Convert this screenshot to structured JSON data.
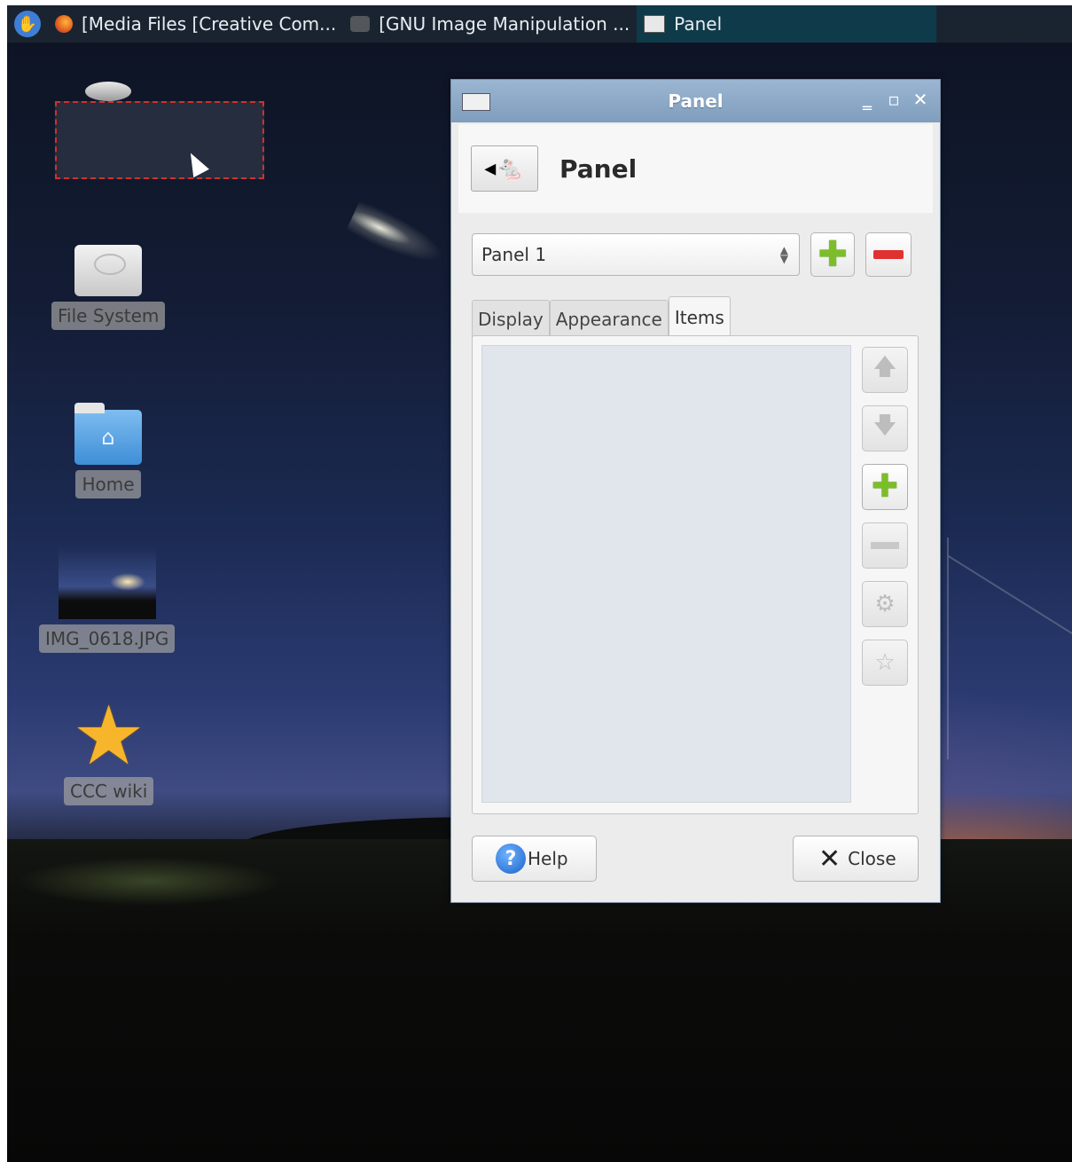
{
  "taskbar": {
    "tasks": [
      {
        "label": "[Media Files [Creative Com...",
        "icon": "firefox-icon"
      },
      {
        "label": "[GNU Image Manipulation ...",
        "icon": "gimp-icon"
      },
      {
        "label": "Panel",
        "icon": "panel-icon",
        "active": true
      }
    ]
  },
  "desktop": {
    "icons": [
      {
        "label": "File System",
        "icon": "hard-disk-icon"
      },
      {
        "label": "Home",
        "icon": "home-folder-icon"
      },
      {
        "label": "IMG_0618.JPG",
        "icon": "image-thumbnail-icon"
      },
      {
        "label": "CCC wiki",
        "icon": "star-icon"
      }
    ]
  },
  "dialog": {
    "title": "Panel",
    "header_title": "Panel",
    "panel_select": {
      "value": "Panel 1"
    },
    "tabs": [
      {
        "label": "Display"
      },
      {
        "label": "Appearance"
      },
      {
        "label": "Items",
        "active": true
      }
    ],
    "items": [],
    "side_buttons": [
      {
        "icon": "arrow-up-icon",
        "enabled": false
      },
      {
        "icon": "arrow-down-icon",
        "enabled": false
      },
      {
        "icon": "add-icon",
        "enabled": true
      },
      {
        "icon": "remove-icon",
        "enabled": false
      },
      {
        "icon": "settings-icon",
        "enabled": false
      },
      {
        "icon": "star-icon",
        "enabled": false
      }
    ],
    "help_label": "Help",
    "close_label": "Close"
  },
  "colors": {
    "taskbar": "#1a2430",
    "active_task": "#0f3a49",
    "titlebar": "#8aa8c8",
    "add_green": "#7cbe2a",
    "remove_red": "#e03030",
    "selection_border": "#d0312d"
  }
}
